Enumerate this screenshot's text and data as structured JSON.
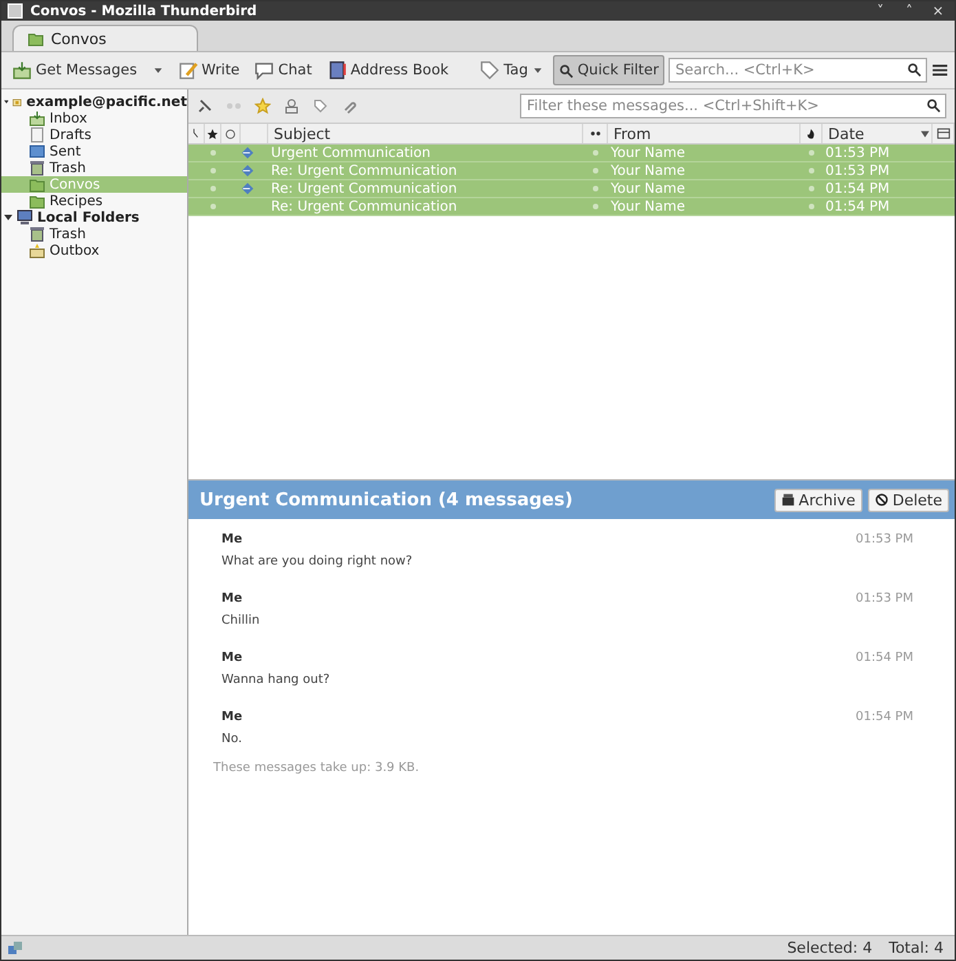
{
  "window": {
    "title": "Convos - Mozilla Thunderbird",
    "controls": [
      "˅",
      "˄",
      "×"
    ]
  },
  "tabs": [
    {
      "label": "Convos",
      "selected": true
    }
  ],
  "toolbar": {
    "buttons": [
      {
        "kind": "get",
        "label": "Get Messages",
        "pressed": false
      },
      {
        "kind": "write",
        "label": "Write",
        "pressed": false
      },
      {
        "kind": "chat",
        "label": "Chat",
        "pressed": false
      },
      {
        "kind": "addressbook",
        "label": "Address Book",
        "pressed": false
      },
      {
        "kind": "tag",
        "label": "Tag",
        "pressed": false
      },
      {
        "kind": "quickfilter",
        "label": "Quick Filter",
        "pressed": true
      }
    ],
    "search": {
      "placeholder": "Search... <Ctrl+K>"
    }
  },
  "sidebar": {
    "items": [
      {
        "kind": "account",
        "label": "example@pacific.net",
        "expanded": true,
        "selected": false,
        "children": [
          {
            "kind": "inbox",
            "label": "Inbox",
            "selected": false
          },
          {
            "kind": "drafts",
            "label": "Drafts",
            "selected": false
          },
          {
            "kind": "sent",
            "label": "Sent",
            "selected": false
          },
          {
            "kind": "trash",
            "label": "Trash",
            "selected": false
          },
          {
            "kind": "folder",
            "label": "Convos",
            "selected": true
          },
          {
            "kind": "folder",
            "label": "Recipes",
            "selected": false
          }
        ]
      },
      {
        "kind": "local",
        "label": "Local Folders",
        "expanded": true,
        "selected": false,
        "children": [
          {
            "kind": "trash",
            "label": "Trash",
            "selected": false
          },
          {
            "kind": "outbox",
            "label": "Outbox",
            "selected": false
          }
        ]
      }
    ]
  },
  "quick_filter": {
    "placeholder": "Filter these messages... <Ctrl+Shift+K>"
  },
  "table": {
    "columns": [
      "Subject",
      "From",
      "Date"
    ],
    "rows": [
      {
        "subject": "Urgent Communication",
        "from": "Your Name",
        "date": "01:53 PM",
        "replied": true,
        "selected": true
      },
      {
        "subject": "Re: Urgent Communication",
        "from": "Your Name",
        "date": "01:53 PM",
        "replied": true,
        "selected": true
      },
      {
        "subject": "Re: Urgent Communication",
        "from": "Your Name",
        "date": "01:54 PM",
        "replied": true,
        "selected": true
      },
      {
        "subject": "Re: Urgent Communication",
        "from": "Your Name",
        "date": "01:54 PM",
        "replied": false,
        "selected": true
      }
    ]
  },
  "conversation": {
    "title": "Urgent Communication (4 messages)",
    "buttons": [
      "Archive",
      "Delete"
    ],
    "messages": [
      {
        "author": "Me",
        "time": "01:53 PM",
        "body": "What are you doing right now?"
      },
      {
        "author": "Me",
        "time": "01:53 PM",
        "body": "Chillin"
      },
      {
        "author": "Me",
        "time": "01:54 PM",
        "body": "Wanna hang out?"
      },
      {
        "author": "Me",
        "time": "01:54 PM",
        "body": "No."
      }
    ],
    "footer": "These messages take up: 3.9 KB."
  },
  "status_bar": {
    "selected": "Selected: 4",
    "total": "Total: 4"
  }
}
